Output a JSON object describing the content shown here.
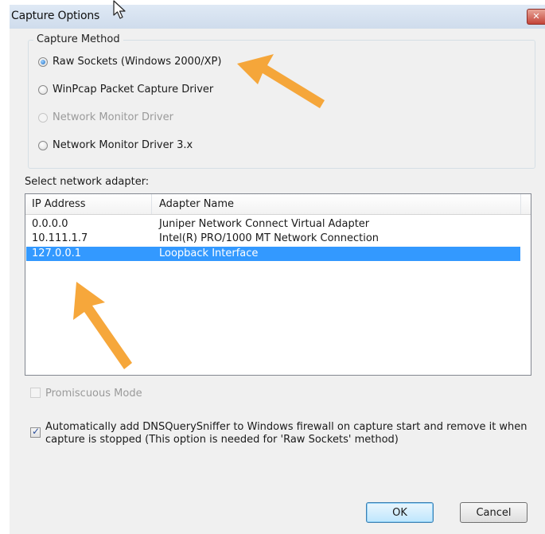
{
  "window": {
    "title": "Capture Options",
    "close_glyph": "✕"
  },
  "capture_method": {
    "legend": "Capture Method",
    "options": [
      {
        "label": "Raw Sockets (Windows 2000/XP)",
        "selected": true,
        "enabled": true
      },
      {
        "label": "WinPcap Packet Capture Driver",
        "selected": false,
        "enabled": true
      },
      {
        "label": "Network Monitor Driver",
        "selected": false,
        "enabled": false
      },
      {
        "label": "Network Monitor Driver 3.x",
        "selected": false,
        "enabled": true
      }
    ]
  },
  "adapter": {
    "label": "Select network adapter:",
    "columns": [
      "IP Address",
      "Adapter Name"
    ],
    "rows": [
      {
        "ip": "0.0.0.0",
        "name": "Juniper Network Connect Virtual Adapter",
        "selected": false
      },
      {
        "ip": "10.111.1.7",
        "name": "Intel(R) PRO/1000 MT Network Connection",
        "selected": false
      },
      {
        "ip": "127.0.0.1",
        "name": "Loopback Interface",
        "selected": true
      }
    ]
  },
  "options": {
    "promiscuous": {
      "label": "Promiscuous Mode",
      "checked": false,
      "enabled": false
    },
    "firewall": {
      "line1": "Automatically add DNSQuerySniffer to Windows firewall on capture start and remove it when",
      "line2": "capture is stopped (This option is needed for 'Raw Sockets' method)",
      "checked": true,
      "enabled": true
    }
  },
  "buttons": {
    "ok": "OK",
    "cancel": "Cancel"
  },
  "colors": {
    "selection": "#3399ff",
    "annotation_arrow": "#f5a02a"
  },
  "icons": {
    "cursor": "mouse-pointer-icon",
    "close": "close-icon"
  }
}
